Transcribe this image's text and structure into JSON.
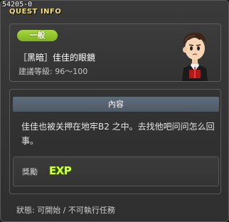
{
  "window": {
    "quest_id": "54205-0",
    "title": "QUEST INFO"
  },
  "quest": {
    "category": "一般",
    "name": "［黑暗］佳佳的眼鏡",
    "level": "建議等級: 96～100"
  },
  "content": {
    "header": "內容",
    "text": "佳佳也被关押在地牢B2 之中。去找他吧问问怎么回事。"
  },
  "reward": {
    "label": "獎勵",
    "exp_text": "EXP"
  },
  "status": {
    "text": "狀態: 可開始 / 不可執行任務"
  },
  "colors": {
    "title": "#f4e06a",
    "category_badge": "#8fc42c",
    "content_header": "#56626f",
    "exp": "#d7ff3b"
  },
  "icons": {
    "npc": "npc-portrait",
    "exp": "exp-icon"
  }
}
